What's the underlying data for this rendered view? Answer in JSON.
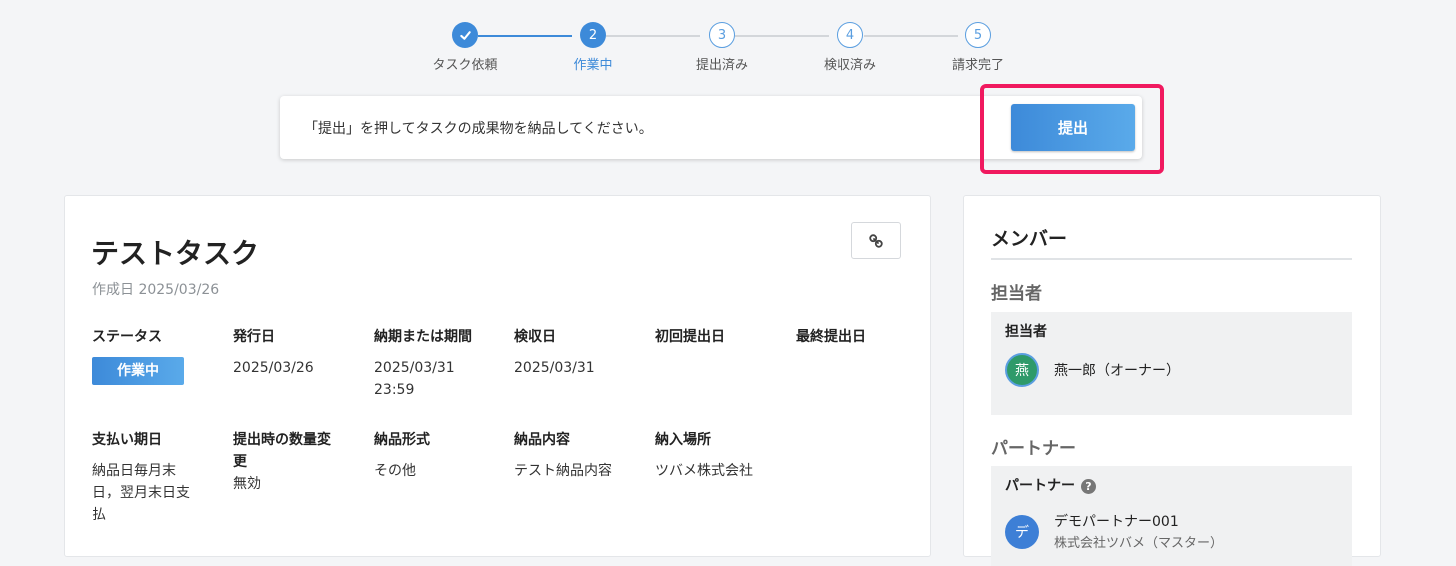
{
  "stepper": {
    "steps": [
      {
        "num": "✓",
        "label": "タスク依頼"
      },
      {
        "num": "2",
        "label": "作業中"
      },
      {
        "num": "3",
        "label": "提出済み"
      },
      {
        "num": "4",
        "label": "検収済み"
      },
      {
        "num": "5",
        "label": "請求完了"
      }
    ]
  },
  "submit_bar": {
    "message": "「提出」を押してタスクの成果物を納品してください。",
    "button_label": "提出"
  },
  "task": {
    "title": "テストタスク",
    "created": "作成日 2025/03/26",
    "fields": {
      "status": {
        "label": "ステータス",
        "value": "作業中"
      },
      "issue_date": {
        "label": "発行日",
        "value": "2025/03/26"
      },
      "deadline": {
        "label": "納期または期間",
        "value_line1": "2025/03/31",
        "value_line2": "23:59"
      },
      "acceptance_date": {
        "label": "検収日",
        "value": "2025/03/31"
      },
      "first_submit": {
        "label": "初回提出日"
      },
      "last_submit": {
        "label": "最終提出日"
      },
      "payment_due": {
        "label": "支払い期日",
        "value_line1": "納品日毎月末",
        "value_line2": "日，翌月末日支",
        "value_line3": "払"
      },
      "qty_change": {
        "label_line1": "提出時の数量変",
        "label_line2": "更",
        "value": "無効"
      },
      "delivery_format": {
        "label": "納品形式",
        "value": "その他"
      },
      "delivery_content": {
        "label": "納品内容",
        "value": "テスト納品内容"
      },
      "delivery_place": {
        "label": "納入場所",
        "value": "ツバメ株式会社"
      }
    }
  },
  "members": {
    "title": "メンバー",
    "assignee_section": "担当者",
    "assignee_box_label": "担当者",
    "assignee": {
      "avatar_char": "燕",
      "name": "燕一郎（オーナー）",
      "color": "#2e9a6a"
    },
    "partner_section": "パートナー",
    "partner_box_label": "パートナー",
    "partner": {
      "avatar_char": "デ",
      "name": "デモパートナー001",
      "sub": "株式会社ツバメ（マスター）",
      "color": "#3d7fd6"
    }
  },
  "colors": {
    "accent": "#3d8ad9",
    "highlight": "#f0195f"
  }
}
